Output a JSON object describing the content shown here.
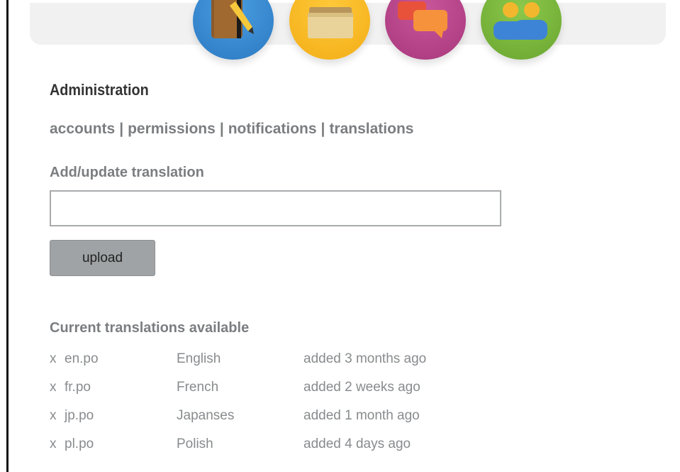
{
  "nav_icons": [
    {
      "name": "notebook-pencil-icon",
      "color": "#2b79c2"
    },
    {
      "name": "folder-icon",
      "color": "#f2ad16"
    },
    {
      "name": "chat-bubbles-icon",
      "color": "#a8377c"
    },
    {
      "name": "users-icon",
      "color": "#6aa631"
    }
  ],
  "page": {
    "heading": "Administration"
  },
  "admin_nav": {
    "items": [
      {
        "label": "accounts"
      },
      {
        "label": "permissions"
      },
      {
        "label": "notifications"
      },
      {
        "label": "translations"
      }
    ],
    "separator": "|"
  },
  "upload_form": {
    "title": "Add/update translation",
    "input_value": "",
    "button_label": "upload"
  },
  "translations": {
    "title": "Current translations available",
    "delete_label": "x",
    "rows": [
      {
        "file": "en.po",
        "language": "English",
        "added": "added 3 months ago"
      },
      {
        "file": "fr.po",
        "language": "French",
        "added": "added 2 weeks ago"
      },
      {
        "file": "jp.po",
        "language": "Japanses",
        "added": "added 1 month ago"
      },
      {
        "file": "pl.po",
        "language": "Polish",
        "added": "added 4 days ago"
      }
    ]
  }
}
